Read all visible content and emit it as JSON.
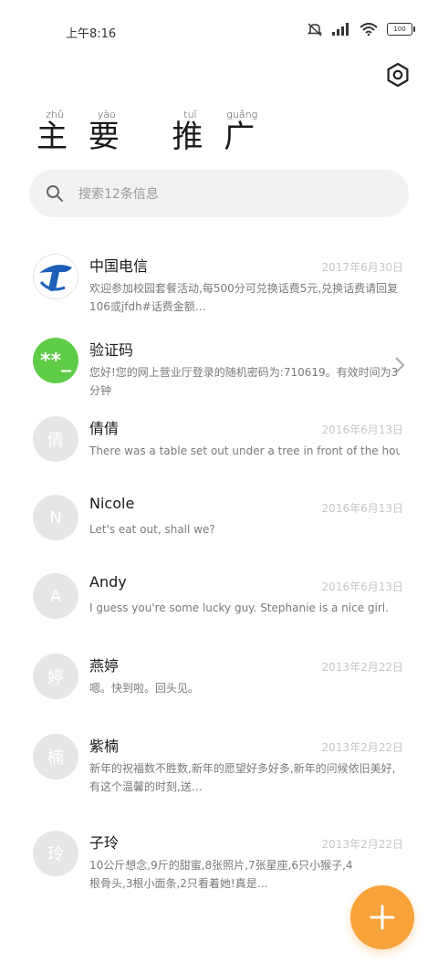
{
  "status_bar": {
    "time": "上午8:16",
    "battery": "100"
  },
  "header": {
    "title_chars": [
      {
        "py": "zhǔ",
        "hz": "主"
      },
      {
        "py": "yào",
        "hz": "要"
      },
      {
        "py": "tuī",
        "hz": "推"
      },
      {
        "py": "guǎng",
        "hz": "广"
      }
    ]
  },
  "search": {
    "placeholder": "搜索12条信息"
  },
  "conversations": [
    {
      "name": "中国电信",
      "time": "2017年6月30日",
      "preview": "欢迎参加校园套餐活动,每500分可兑换话费5元,兑换话费请回复106或jfdh#话费金额…",
      "avatar_text": "",
      "avatar_type": "telecom"
    },
    {
      "name": "验证码",
      "time": "",
      "preview": "您好!您的网上营业厅登录的随机密码为:710619。有效时间为3分钟",
      "avatar_text": "**_",
      "avatar_type": "green"
    },
    {
      "name": "倩倩",
      "time": "2016年6月13日",
      "preview": "There was a table set out under a tree in front of the hous",
      "avatar_text": "倩",
      "avatar_type": "gray"
    },
    {
      "name": "Nicole",
      "time": "2016年6月13日",
      "preview": "Let's eat out, shall we?",
      "avatar_text": "N",
      "avatar_type": "gray"
    },
    {
      "name": "Andy",
      "time": "2016年6月13日",
      "preview": "I guess you're some lucky guy. Stephanie is a nice girl.",
      "avatar_text": "A",
      "avatar_type": "gray"
    },
    {
      "name": "燕婷",
      "time": "2013年2月22日",
      "preview": "嗯。快到啦。回头见。",
      "avatar_text": "婷",
      "avatar_type": "gray"
    },
    {
      "name": "紫楠",
      "time": "2013年2月22日",
      "preview": "新年的祝福数不胜数,新年的愿望好多好多,新年的问候依旧美好,有这个温馨的时刻,送…",
      "avatar_text": "楠",
      "avatar_type": "gray"
    },
    {
      "name": "子玲",
      "time": "2013年2月22日",
      "preview": "10公斤想念,9斤的甜蜜,8张照片,7张星座,6只小猴子,4根骨头,3根小面条,2只看着她!真是…",
      "avatar_text": "玲",
      "avatar_type": "gray"
    }
  ],
  "colors": {
    "accent": "#f8a23a",
    "green_avatar": "#5fcc47",
    "avatar_gray": "#e5e6e8",
    "search_bg": "#f1f2f4"
  },
  "icons": {
    "settings": "settings-hexagon-icon",
    "search": "search-icon",
    "fab": "plus-icon",
    "chevron": "chevron-right-icon"
  }
}
